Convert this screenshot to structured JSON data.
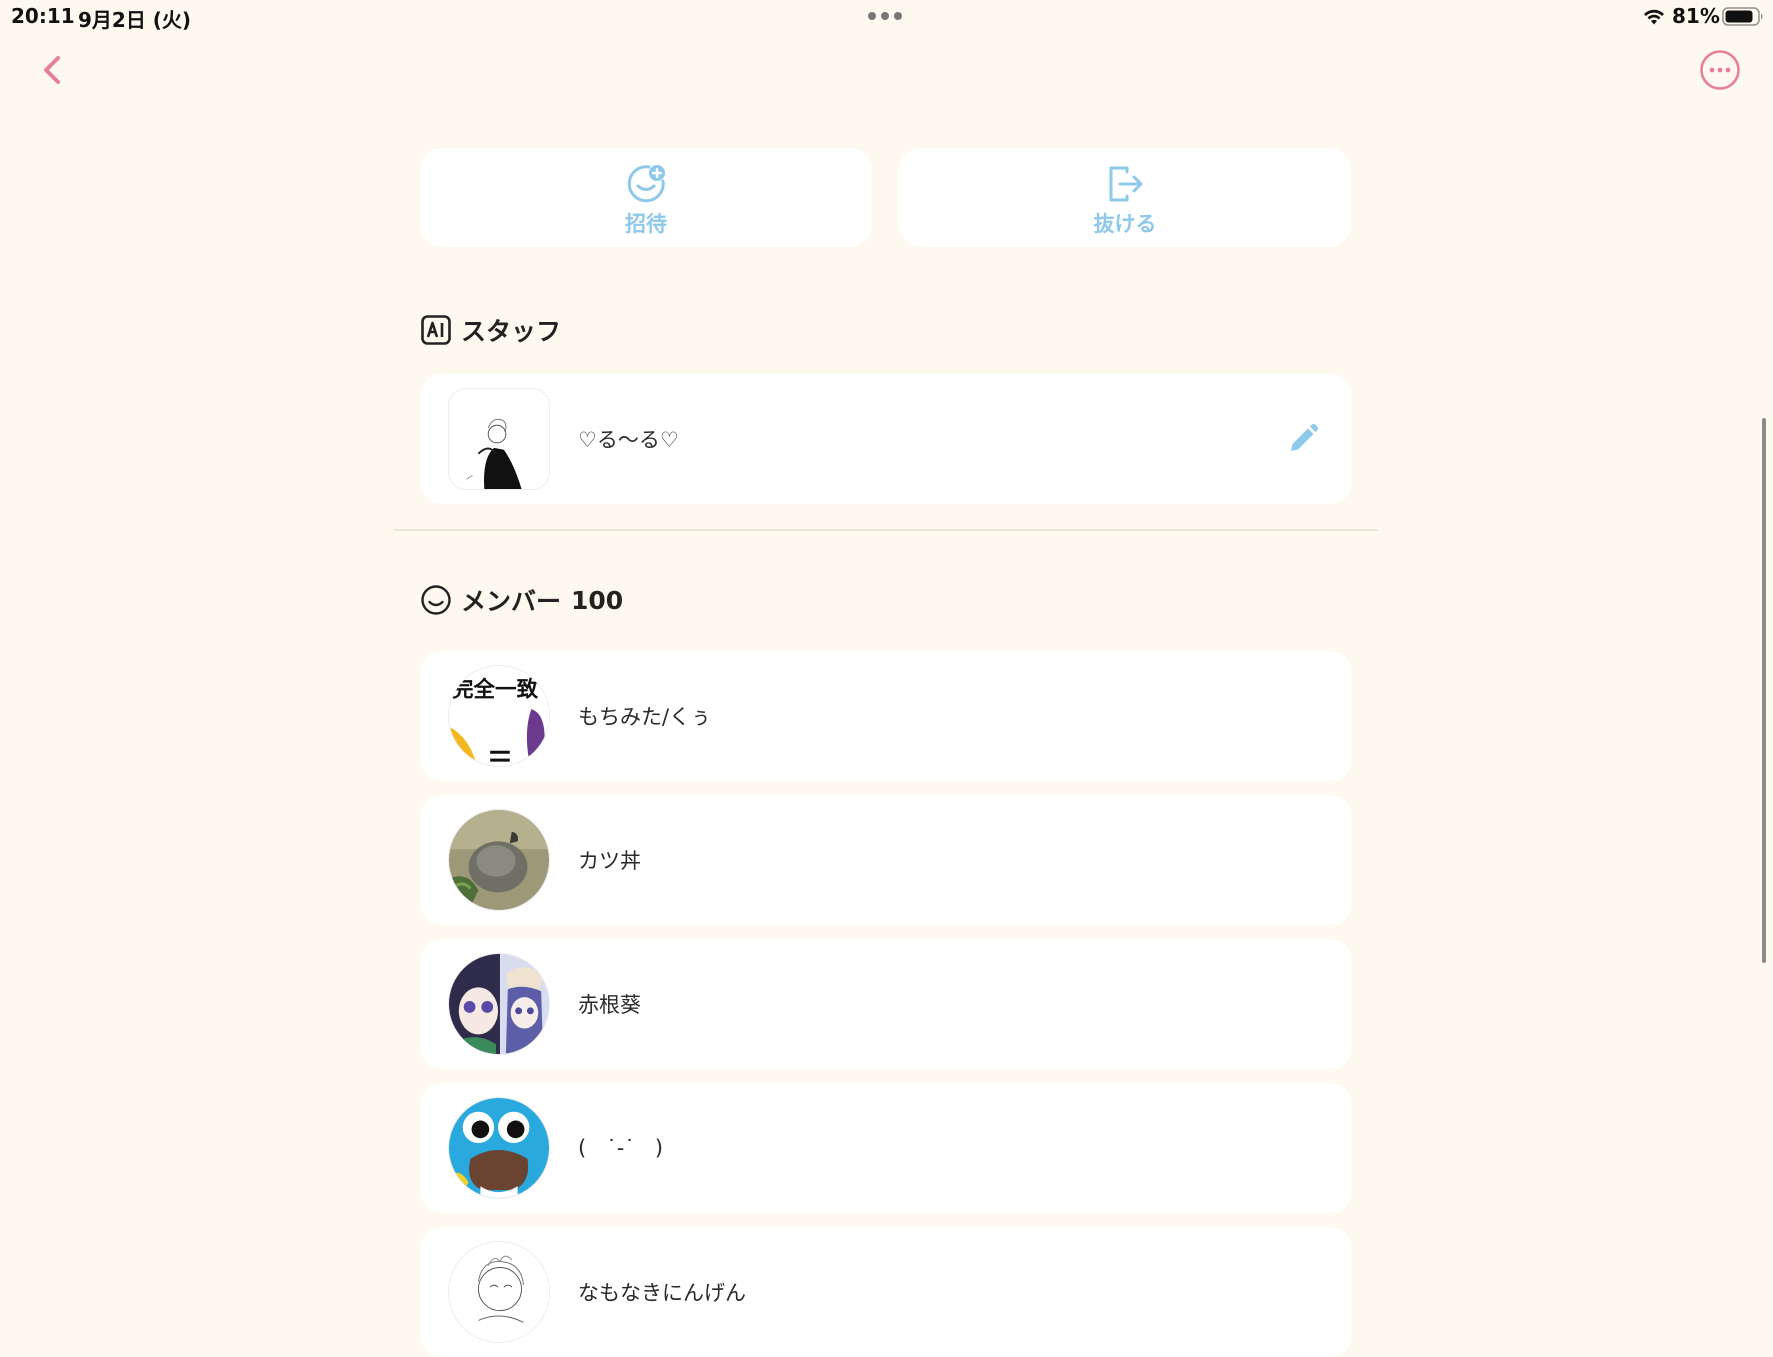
{
  "status_bar": {
    "time": "20:11",
    "date": "9月2日 (火)",
    "battery": "81%"
  },
  "colors": {
    "accent_pink": "#e87f98",
    "accent_blue": "#8ec8ea",
    "background": "#fef9ee"
  },
  "actions": {
    "invite_label": "招待",
    "leave_label": "抜ける"
  },
  "staff_section": {
    "title": "スタッフ",
    "members": [
      {
        "name": "♡る～る♡"
      }
    ]
  },
  "member_section": {
    "title": "メンバー",
    "count": "100",
    "members": [
      {
        "name": "もちみた/くぅ",
        "avatar_text": "完全一致"
      },
      {
        "name": "カツ丼"
      },
      {
        "name": "赤根葵"
      },
      {
        "name": "(   ˙-˙   )"
      },
      {
        "name": "なもなきにんげん"
      }
    ]
  }
}
